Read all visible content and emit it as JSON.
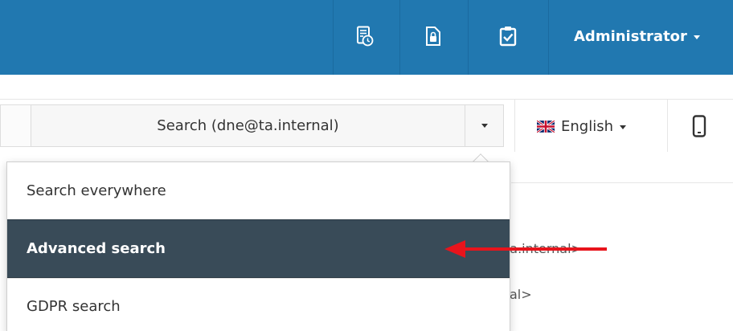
{
  "topbar": {
    "color": "#2178b0",
    "icons": [
      "report-clock-icon",
      "file-lock-icon",
      "clipboard-check-icon"
    ],
    "user_label": "Administrator"
  },
  "toolbar": {
    "search_label": "Search (dne@ta.internal)",
    "language_label": "English",
    "language_flag": "uk-flag-icon",
    "device_icon": "mobile-phone-icon"
  },
  "background": {
    "row1": "ta.internal>",
    "row2": "al>"
  },
  "search_menu": {
    "items": [
      {
        "label": "Search everywhere",
        "active": false
      },
      {
        "label": "Advanced search",
        "active": true
      },
      {
        "label": "GDPR search",
        "active": false
      }
    ],
    "active_color": "#394b58"
  },
  "annotation": {
    "arrow_color": "#e8141c"
  }
}
